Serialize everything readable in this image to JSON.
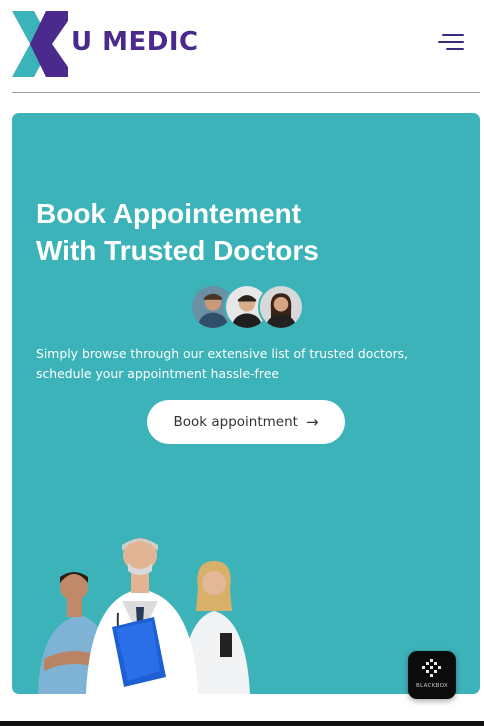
{
  "header": {
    "logo_text": "U MEDIC",
    "menu_icon": "hamburger-menu-icon"
  },
  "hero": {
    "title_line1": "Book Appointement",
    "title_line2": "With Trusted Doctors",
    "description": "Simply browse through our extensive list of trusted doctors, schedule your appointment hassle-free",
    "cta_label": "Book appointment",
    "cta_icon": "arrow-right-icon",
    "background_color": "#3cb3b9"
  },
  "badge": {
    "label": "BLACKBOX",
    "icon": "blackbox-logo-icon"
  },
  "colors": {
    "brand_purple": "#4a2a8c",
    "brand_teal": "#3cb3b9"
  }
}
